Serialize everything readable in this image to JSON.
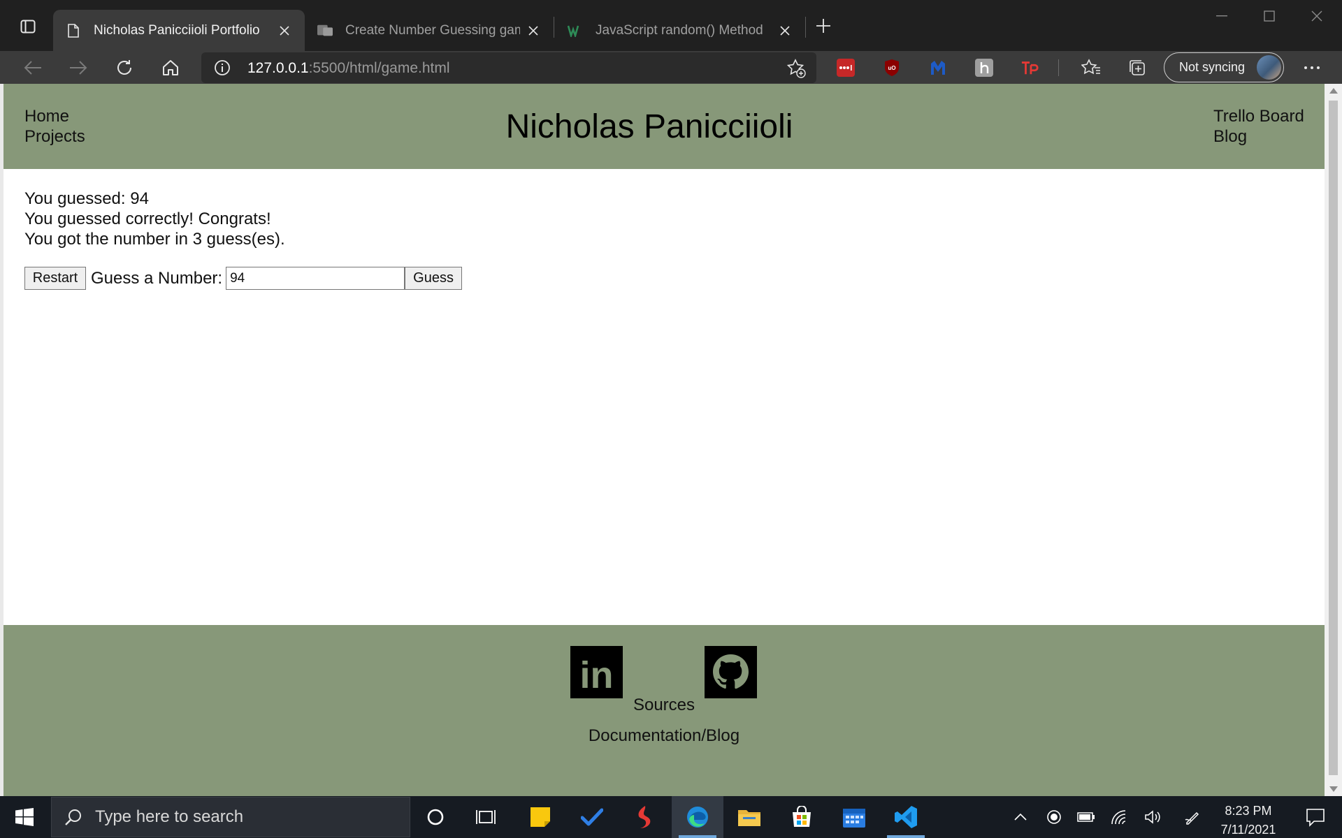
{
  "browser": {
    "tabs": [
      {
        "title": "Nicholas Panicciioli Portfolio",
        "active": true
      },
      {
        "title": "Create Number Guessing game",
        "active": false
      },
      {
        "title": "JavaScript random() Method",
        "active": false
      }
    ],
    "url_host": "127.0.0.1",
    "url_rest": ":5500/html/game.html",
    "sync_label": "Not syncing"
  },
  "site": {
    "title": "Nicholas Panicciioli",
    "nav_left": [
      "Home",
      "Projects"
    ],
    "nav_right": [
      "Trello Board",
      "Blog"
    ]
  },
  "game": {
    "messages": [
      "You guessed: 94",
      "You guessed correctly! Congrats!",
      "You got the number in 3 guess(es)."
    ],
    "restart_label": "Restart",
    "guess_prompt": "Guess a Number:",
    "input_value": "94",
    "guess_label": "Guess"
  },
  "footer": {
    "sources_label": "Sources",
    "docs_label": "Documentation/Blog",
    "linkedin_text": "in"
  },
  "taskbar": {
    "search_placeholder": "Type here to search",
    "time": "8:23 PM",
    "date": "7/11/2021"
  },
  "colors": {
    "header_bg": "#879879",
    "footer_bg": "#879879",
    "browser_chrome": "#3b3b3b",
    "taskbar": "#161b22"
  }
}
